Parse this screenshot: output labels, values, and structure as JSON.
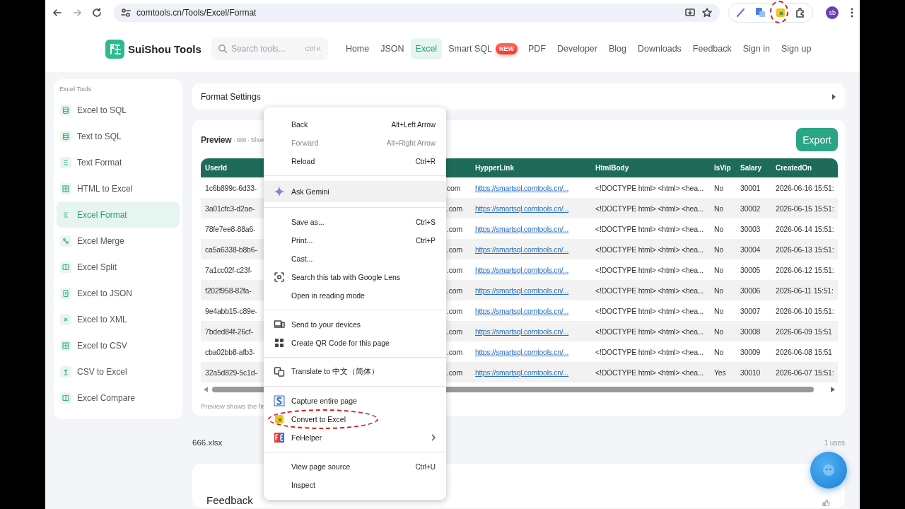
{
  "browser": {
    "url": "comtools.cn/Tools/Excel/Format",
    "profile": "sb",
    "extensions": [
      {
        "kind": "pen",
        "annotated": false
      },
      {
        "kind": "translate",
        "annotated": false
      },
      {
        "kind": "excel",
        "annotated": true
      },
      {
        "kind": "puzzle",
        "annotated": false
      }
    ]
  },
  "header": {
    "brand": "SuiShou Tools",
    "search": {
      "placeholder": "Search tools...",
      "shortcut": "Ctrl K"
    },
    "nav": [
      {
        "label": "Home",
        "selected": false
      },
      {
        "label": "JSON",
        "selected": false
      },
      {
        "label": "Excel",
        "selected": true
      },
      {
        "label": "Smart SQL",
        "selected": false,
        "badge": "NEW"
      },
      {
        "label": "PDF",
        "selected": false
      },
      {
        "label": "Developer",
        "selected": false
      },
      {
        "label": "Blog",
        "selected": false
      },
      {
        "label": "Downloads",
        "selected": false
      },
      {
        "label": "Feedback",
        "selected": false
      },
      {
        "label": "Sign in",
        "selected": false
      },
      {
        "label": "Sign up",
        "selected": false
      }
    ]
  },
  "sidebar": {
    "heading": "Excel Tools",
    "items": [
      {
        "label": "Excel to SQL",
        "kind": "database",
        "selected": false
      },
      {
        "label": "Text to SQL",
        "kind": "database",
        "selected": false
      },
      {
        "label": "Text Format",
        "kind": "lines",
        "selected": false
      },
      {
        "label": "HTML to Excel",
        "kind": "grid",
        "selected": false
      },
      {
        "label": "Excel Format",
        "kind": "lines",
        "selected": true
      },
      {
        "label": "Excel Merge",
        "kind": "merge",
        "selected": false
      },
      {
        "label": "Excel Split",
        "kind": "columns",
        "selected": false
      },
      {
        "label": "Excel to JSON",
        "kind": "file",
        "selected": false
      },
      {
        "label": "Excel to XML",
        "kind": "cross",
        "selected": false
      },
      {
        "label": "Excel to CSV",
        "kind": "grid",
        "selected": false
      },
      {
        "label": "CSV to Excel",
        "kind": "upload",
        "selected": false
      },
      {
        "label": "Excel Compare",
        "kind": "columns",
        "selected": false
      }
    ]
  },
  "format_settings": {
    "title": "Format Settings",
    "expanded": false
  },
  "preview": {
    "title": "Preview",
    "meta": "· 666 · Show",
    "export": "Export",
    "table": {
      "columns": [
        {
          "label": "UserId",
          "kind": "text"
        },
        {
          "kind": "text"
        },
        {
          "label": "HypperLink",
          "kind": "link"
        },
        {
          "label": "HtmlBody",
          "kind": "text"
        },
        {
          "label": "IsVip",
          "kind": "text"
        },
        {
          "label": "Salary",
          "kind": "text"
        },
        {
          "label": "CreatedOn",
          "kind": "text"
        }
      ],
      "rows": [
        [
          "1c6b899c-6d33-",
          "com",
          "https://smartsql.comtools.cn/...",
          "<!DOCTYPE html> <html> <hea...",
          "No",
          "30001",
          "2026-06-16 15:51:"
        ],
        [
          "3a01cfc3-d2ae-",
          ".com",
          "https://smartsql.comtools.cn/...",
          "<!DOCTYPE html> <html> <hea...",
          "No",
          "30002",
          "2026-06-15 15:51:"
        ],
        [
          "78fe7ee8-88a6-",
          ".com",
          "https://smartsql.comtools.cn/...",
          "<!DOCTYPE html> <html> <hea...",
          "No",
          "30003",
          "2026-06-14 15:51:"
        ],
        [
          "ca5a6338-b8b6-",
          ".com",
          "https://smartsql.comtools.cn/...",
          "<!DOCTYPE html> <html> <hea...",
          "No",
          "30004",
          "2026-06-13 15:51:"
        ],
        [
          "7a1cc02f-c23f-",
          ".com",
          "https://smartsql.comtools.cn/...",
          "<!DOCTYPE html> <html> <hea...",
          "No",
          "30005",
          "2026-06-12 15:51:"
        ],
        [
          "f202f958-82fa-",
          ".com",
          "https://smartsql.comtools.cn/...",
          "<!DOCTYPE html> <html> <hea...",
          "No",
          "30006",
          "2026-06-11 15:51:"
        ],
        [
          "9e4abb15-c89e-",
          ".com",
          "https://smartsql.comtools.cn/...",
          "<!DOCTYPE html> <html> <hea...",
          "No",
          "30007",
          "2026-06-10 15:51:"
        ],
        [
          "7bded84f-26cf-",
          ".com",
          "https://smartsql.comtools.cn/...",
          "<!DOCTYPE html> <html> <hea...",
          "No",
          "30008",
          "2026-06-09 15:51"
        ],
        [
          "cba02bb8-afb3-",
          ".com",
          "https://smartsql.comtools.cn/...",
          "<!DOCTYPE html> <html> <hea...",
          "No",
          "30009",
          "2026-06-08 15:51"
        ],
        [
          "32a5d829-5c1d-",
          ".com",
          "https://smartsql.comtools.cn/...",
          "<!DOCTYPE html> <html> <hea...",
          "Yes",
          "30010",
          "2026-06-07 15:51:"
        ]
      ]
    },
    "note": "Preview shows the fir"
  },
  "file": {
    "name": "666.xlsx",
    "uses": "1 uses"
  },
  "feedback": {
    "title": "Feedback"
  },
  "context_menu": {
    "groups": [
      {
        "items": [
          {
            "label": "Back",
            "shortcut": "Alt+Left Arrow",
            "disabled": false,
            "highlighted": false,
            "annotated": false,
            "submenu": false
          },
          {
            "label": "Forward",
            "shortcut": "Alt+Right Arrow",
            "disabled": true,
            "highlighted": false,
            "annotated": false,
            "submenu": false
          },
          {
            "label": "Reload",
            "shortcut": "Ctrl+R",
            "disabled": false,
            "highlighted": false,
            "annotated": false,
            "submenu": false
          }
        ]
      },
      {
        "items": [
          {
            "label": "Ask Gemini",
            "kind": "gemini",
            "disabled": false,
            "highlighted": true,
            "annotated": false,
            "submenu": false
          }
        ]
      },
      {
        "items": [
          {
            "label": "Save as...",
            "shortcut": "Ctrl+S",
            "disabled": false,
            "highlighted": false,
            "annotated": false,
            "submenu": false
          },
          {
            "label": "Print...",
            "shortcut": "Ctrl+P",
            "disabled": false,
            "highlighted": false,
            "annotated": false,
            "submenu": false
          },
          {
            "label": "Cast...",
            "disabled": false,
            "highlighted": false,
            "annotated": false,
            "submenu": false
          },
          {
            "label": "Search this tab with Google Lens",
            "kind": "lens",
            "disabled": false,
            "highlighted": false,
            "annotated": false,
            "submenu": false
          },
          {
            "label": "Open in reading mode",
            "disabled": false,
            "highlighted": false,
            "annotated": false,
            "submenu": false
          }
        ]
      },
      {
        "items": [
          {
            "label": "Send to your devices",
            "kind": "devices",
            "disabled": false,
            "highlighted": false,
            "annotated": false,
            "submenu": false
          },
          {
            "label": "Create QR Code for this page",
            "kind": "qr",
            "disabled": false,
            "highlighted": false,
            "annotated": false,
            "submenu": false
          }
        ]
      },
      {
        "items": [
          {
            "label": "Translate to 中文（简体）",
            "kind": "translate",
            "disabled": false,
            "highlighted": false,
            "annotated": false,
            "submenu": false
          }
        ]
      },
      {
        "items": [
          {
            "label": "Capture entire page",
            "kind": "capture",
            "disabled": false,
            "highlighted": false,
            "annotated": false,
            "submenu": false
          },
          {
            "label": "Convert to Excel",
            "kind": "excel",
            "disabled": false,
            "highlighted": false,
            "annotated": true,
            "submenu": false
          },
          {
            "label": "FeHelper",
            "kind": "fehelper",
            "disabled": false,
            "highlighted": false,
            "annotated": false,
            "submenu": true
          }
        ]
      },
      {
        "items": [
          {
            "label": "View page source",
            "shortcut": "Ctrl+U",
            "disabled": false,
            "highlighted": false,
            "annotated": false,
            "submenu": false
          },
          {
            "label": "Inspect",
            "disabled": false,
            "highlighted": false,
            "annotated": false,
            "submenu": false
          }
        ]
      }
    ]
  }
}
